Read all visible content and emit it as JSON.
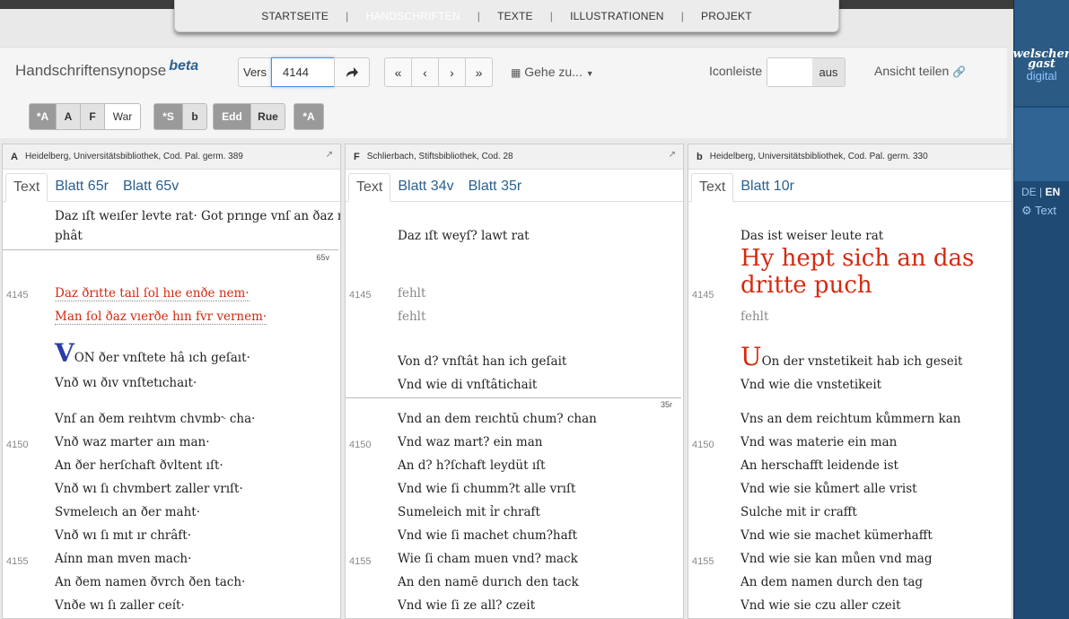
{
  "nav": {
    "items": [
      "STARTSEITE",
      "HANDSCHRIFTEN",
      "TEXTE",
      "ILLUSTRATIONEN",
      "PROJEKT"
    ],
    "separator": "|"
  },
  "header": {
    "title": "Handschriftensynopse",
    "beta": "beta",
    "vers_label": "Vers",
    "vers_value": "4144",
    "gehe_zu": "Gehe zu...",
    "iconleiste_label": "Iconleiste",
    "iconleiste_off": "aus",
    "ansicht_teilen": "Ansicht teilen"
  },
  "nav_buttons": [
    "«",
    "‹",
    "›",
    "»"
  ],
  "manuscripts": {
    "group1": [
      "*A",
      "A",
      "F",
      "War"
    ],
    "group2": [
      "*S",
      "b"
    ],
    "group3": [
      "Edd",
      "Rue"
    ],
    "group4": [
      "*A"
    ]
  },
  "panels": [
    {
      "sigle": "A",
      "name": "Heidelberg, Universitätsbibliothek, Cod. Pal. germ. 389",
      "tabs": [
        "Text",
        "Blatt 65r",
        "Blatt 65v"
      ],
      "folio": "65v",
      "lines": [
        "Daz ıſt weıſer levte rat· Got prınge vnſ an ðaz reht",
        "phât",
        "Daz ðrıtte taıl ſol hıe enðe nem·",
        "Man ſol ðaz vıerðe hın fvr vernem·",
        "ON ðer vnſtete hâ ıch geſaıt·",
        "Vnð wı ðıv vnſtetıchaıt·",
        "Vnſ an ðem reıhtvm chvmb˞ cha·",
        "Vnð waz marter aın man·",
        "An ðer herſchaft ðvltent ıſt·",
        "Vnð wı ſı chvmbert zaller vrıſt·",
        "Svmeleıch an ðer maht·",
        "Vnð wı ſı mıt ır chrâft·",
        "Aínn man mven mach·",
        "An ðem namen ðvrch ðen tach·",
        "Vnðe wı ſı zaller ceít·"
      ],
      "initial": "V",
      "numbers": [
        "4145",
        "4150",
        "4155"
      ]
    },
    {
      "sigle": "F",
      "name": "Schlierbach, Stiftsbibliothek, Cod. 28",
      "tabs": [
        "Text",
        "Blatt 34v",
        "Blatt 35r"
      ],
      "folio": "35r",
      "lines": [
        "Daz ıſt weyſ? lawt rat",
        "fehlt",
        "fehlt",
        "Von d? vnſtât han ich geſait",
        "Vnd wie di vnſtâtichait",
        "Vnd an dem reıchtŭ chum? chan",
        "Vnd waz mart? ein man",
        "An d? h?ſchaft leydüt ıſt",
        "Vnd wie ſi chumm?t alle vrıſt",
        "Sumeleich mit ỉr chraft",
        "Vnd wie ſi machet chum?haft",
        "Wie ſi cham muen vnd? mack",
        "An den namē durıch den tack",
        "Vnd wie ſi ze all? czeit"
      ],
      "numbers": [
        "4145",
        "4150",
        "4155"
      ]
    },
    {
      "sigle": "b",
      "name": "Heidelberg, Universitätsbibliothek, Cod. Pal. germ. 330",
      "tabs": [
        "Text",
        "Blatt 10r"
      ],
      "heading": "Hy hept sich an das dritte puch",
      "lines": [
        "Das ist weiser leute rat",
        "fehlt",
        "On der vnstetikeit hab ich geseit",
        "Vnd wie die vnstetikeit",
        "Vns an dem reichtum kůmmern kan",
        "Vnd was materie ein man",
        "An herschafft leidende ist",
        "Vnd wie sie kůmert alle vrist",
        "Sulche mit ir crafft",
        "Vnd wie sie machet kümerhafft",
        "Vnd wie sie kan můen vnd mag",
        "An dem namen durch den tag",
        "Vnd wie sie czu aller czeit"
      ],
      "initial": "U",
      "numbers": [
        "4145",
        "4150",
        "4155"
      ]
    }
  ],
  "sidebar": {
    "logo_line1": "welscher",
    "logo_line2": "gast",
    "logo_line3": "digital",
    "lang_de": "DE",
    "lang_sep": "|",
    "lang_en": "EN",
    "text_label": "Text"
  }
}
